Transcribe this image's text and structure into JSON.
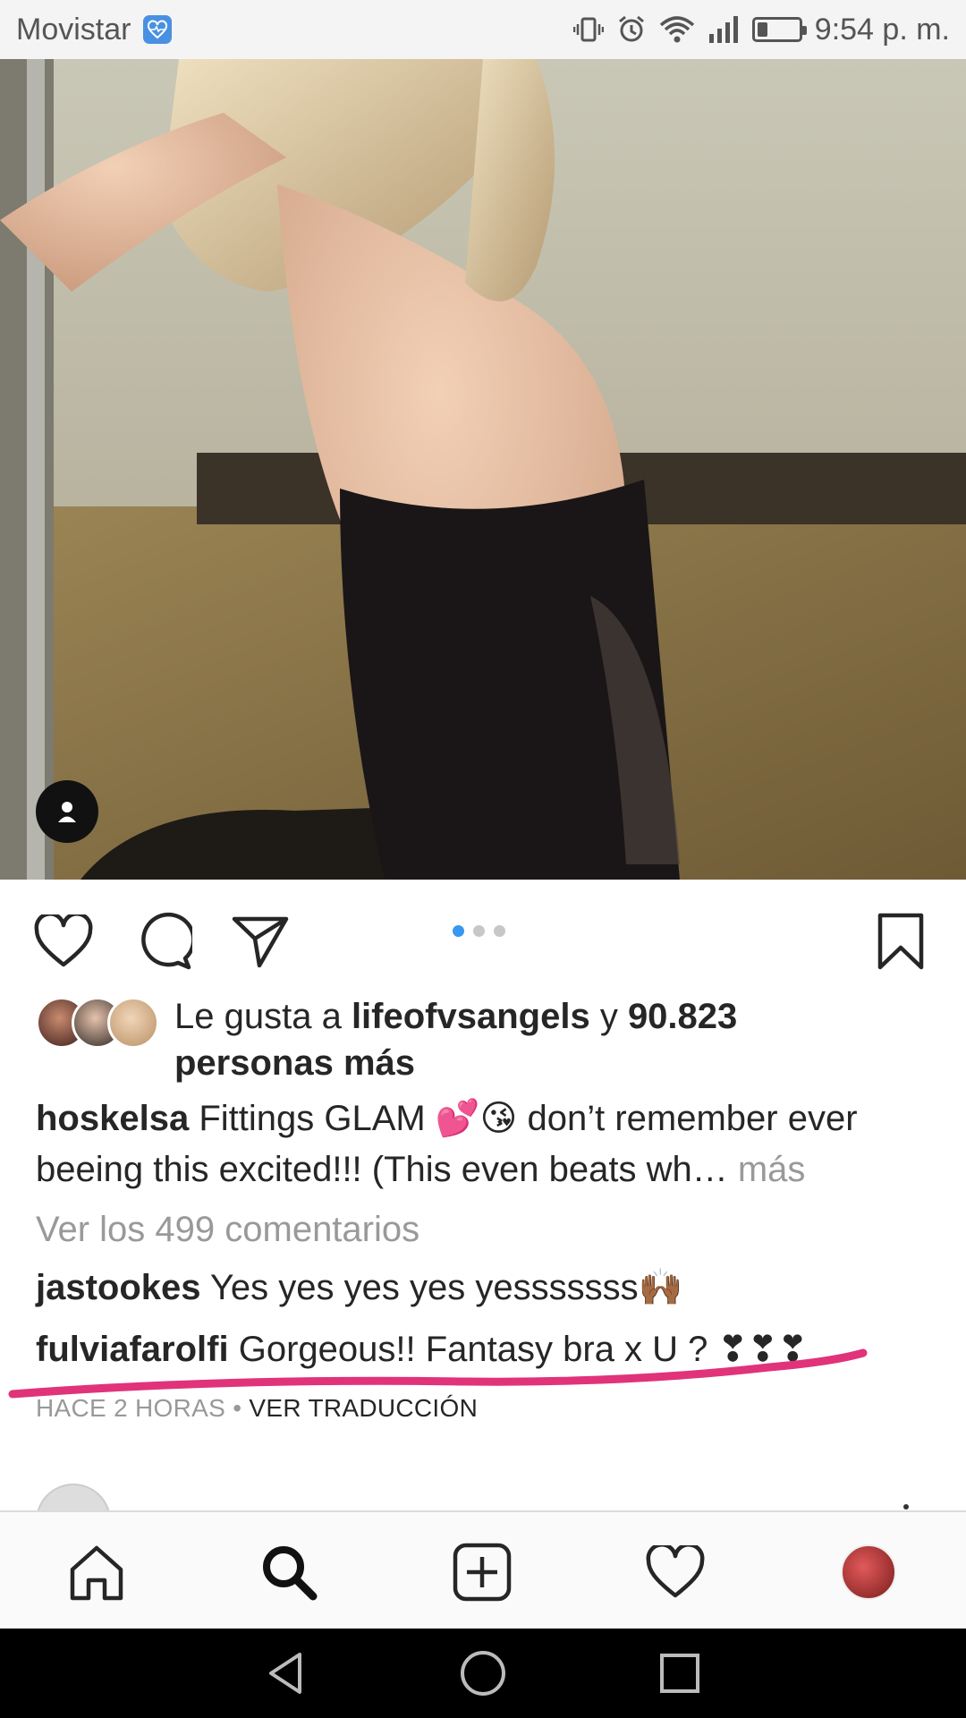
{
  "status_bar": {
    "carrier": "Movistar",
    "time": "9:54 p. m.",
    "icons": [
      "health-icon",
      "vibrate-icon",
      "alarm-icon",
      "wifi-icon",
      "signal-icon",
      "battery-icon"
    ],
    "battery_level": 0.25
  },
  "post": {
    "carousel": {
      "count": 3,
      "active_index": 0
    },
    "likes": {
      "prefix": "Le gusta a ",
      "user": "lifeofvsangels",
      "connector": " y ",
      "count": "90.823",
      "suffix": "personas más"
    },
    "caption": {
      "username": "hoskelsa",
      "text": "Fittings GLAM 💕😘 don’t remember ever beeing this excited!!! (This even beats wh…",
      "more": "más"
    },
    "view_comments": "Ver los 499 comentarios",
    "comments": [
      {
        "username": "jastookes",
        "text": "Yes yes yes yes yesssssss🙌🏾"
      },
      {
        "username": "fulviafarolfi",
        "text": "Gorgeous!! Fantasy bra x U ? ❣❣❣"
      }
    ],
    "time_ago": "HACE 2 HORAS",
    "separator": "•",
    "translate": "VER TRADUCCIÓN"
  },
  "colors": {
    "accent_blue": "#3897f0",
    "highlight_stroke": "#e0337a",
    "text": "#262626",
    "muted": "#999999"
  }
}
